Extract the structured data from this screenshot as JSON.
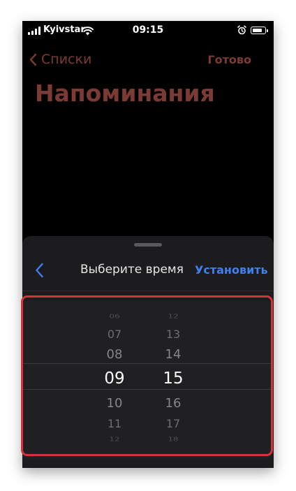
{
  "status_bar": {
    "carrier": "Kyivstar",
    "time": "09:15",
    "battery_level": 0.85
  },
  "nav": {
    "back_label": "Списки",
    "done_label": "Готово",
    "title": "Напоминания"
  },
  "sheet": {
    "title": "Выберите время",
    "set_label": "Установить"
  },
  "picker": {
    "hours": [
      "06",
      "07",
      "08",
      "09",
      "10",
      "11",
      "12"
    ],
    "minutes": [
      "12",
      "13",
      "14",
      "15",
      "16",
      "17",
      "18"
    ],
    "selected_hour": "09",
    "selected_minute": "15"
  },
  "colors": {
    "accent_red": "#7c3a34",
    "accent_blue": "#3f7ff0",
    "highlight_red": "#d7323c"
  }
}
